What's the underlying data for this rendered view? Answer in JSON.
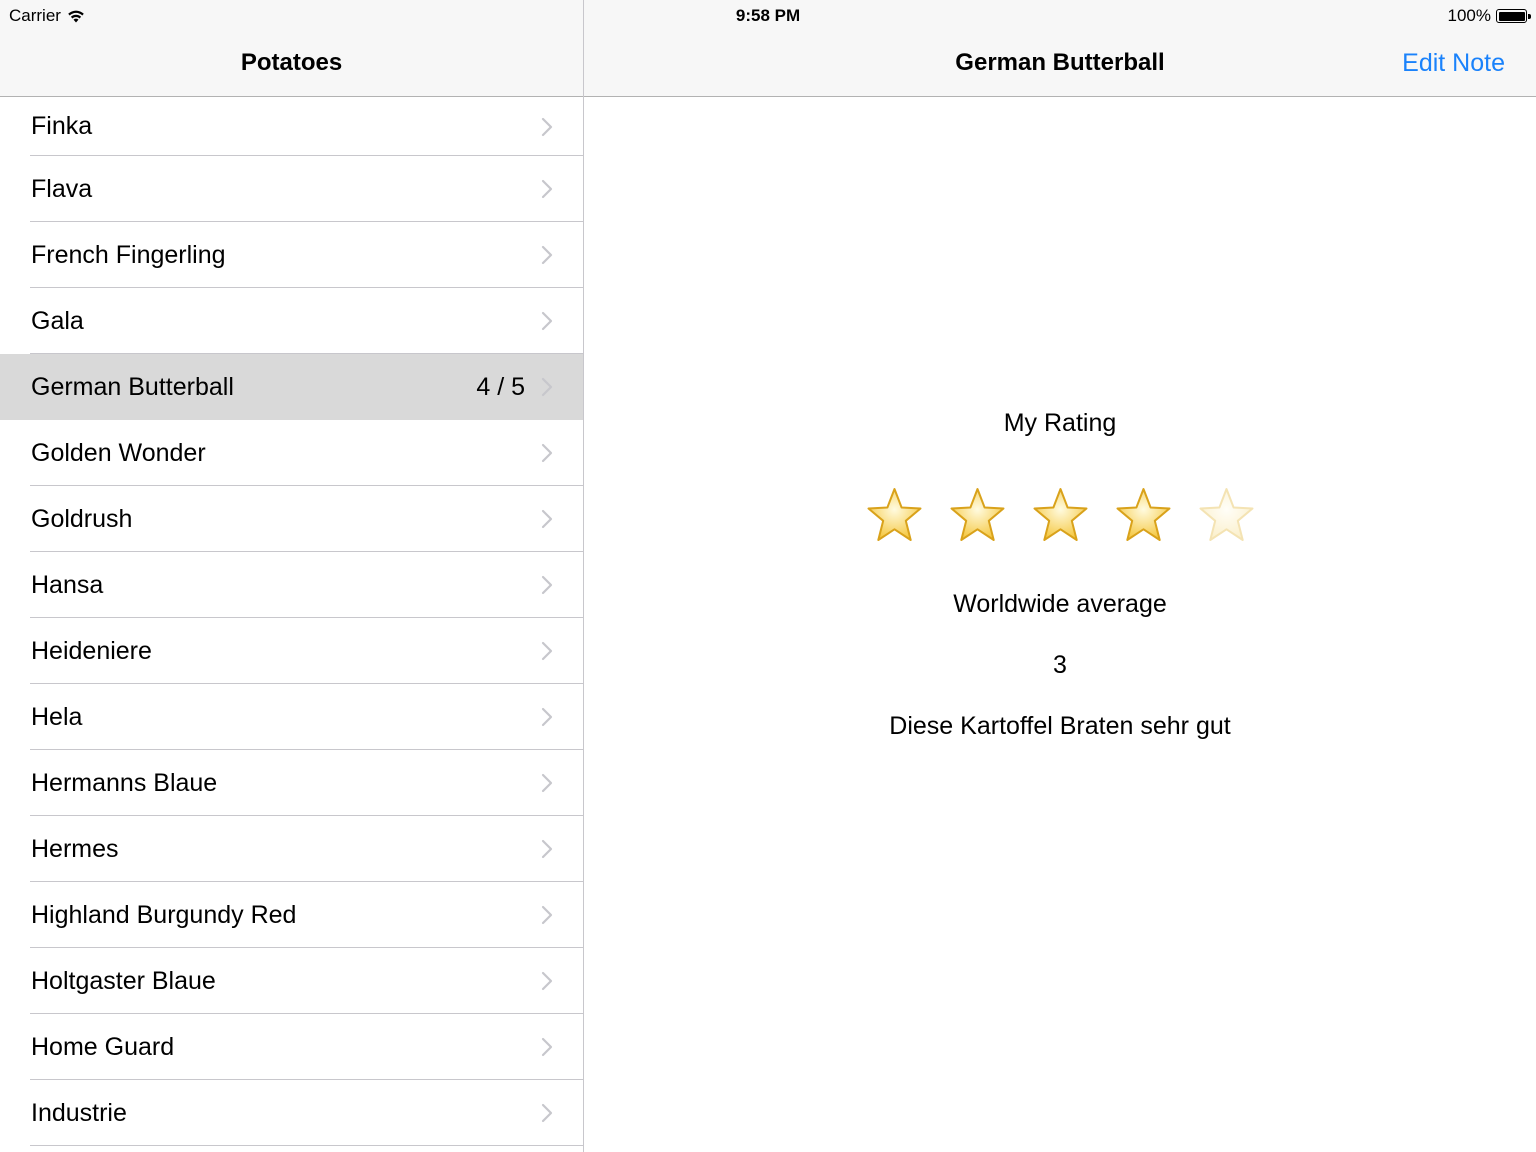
{
  "status_bar": {
    "carrier": "Carrier",
    "time": "9:58 PM",
    "battery": "100%"
  },
  "master": {
    "title": "Potatoes",
    "items": [
      {
        "label": "Finka",
        "detail": ""
      },
      {
        "label": "Flava",
        "detail": ""
      },
      {
        "label": "French Fingerling",
        "detail": ""
      },
      {
        "label": "Gala",
        "detail": ""
      },
      {
        "label": "German Butterball",
        "detail": "4 / 5",
        "selected": true
      },
      {
        "label": "Golden Wonder",
        "detail": ""
      },
      {
        "label": "Goldrush",
        "detail": ""
      },
      {
        "label": "Hansa",
        "detail": ""
      },
      {
        "label": "Heideniere",
        "detail": ""
      },
      {
        "label": "Hela",
        "detail": ""
      },
      {
        "label": "Hermanns Blaue",
        "detail": ""
      },
      {
        "label": "Hermes",
        "detail": ""
      },
      {
        "label": "Highland Burgundy Red",
        "detail": ""
      },
      {
        "label": "Holtgaster Blaue",
        "detail": ""
      },
      {
        "label": "Home Guard",
        "detail": ""
      },
      {
        "label": "Industrie",
        "detail": ""
      }
    ]
  },
  "detail": {
    "title": "German Butterball",
    "edit_button": "Edit Note",
    "my_rating_label": "My Rating",
    "rating": {
      "value": 4,
      "max": 5
    },
    "average_label": "Worldwide average",
    "average_value": "3",
    "note": "Diese Kartoffel Braten sehr gut"
  },
  "colors": {
    "accent": "#1a82fb",
    "selected_row": "#d9d9d9",
    "separator": "#c8c7cc"
  }
}
